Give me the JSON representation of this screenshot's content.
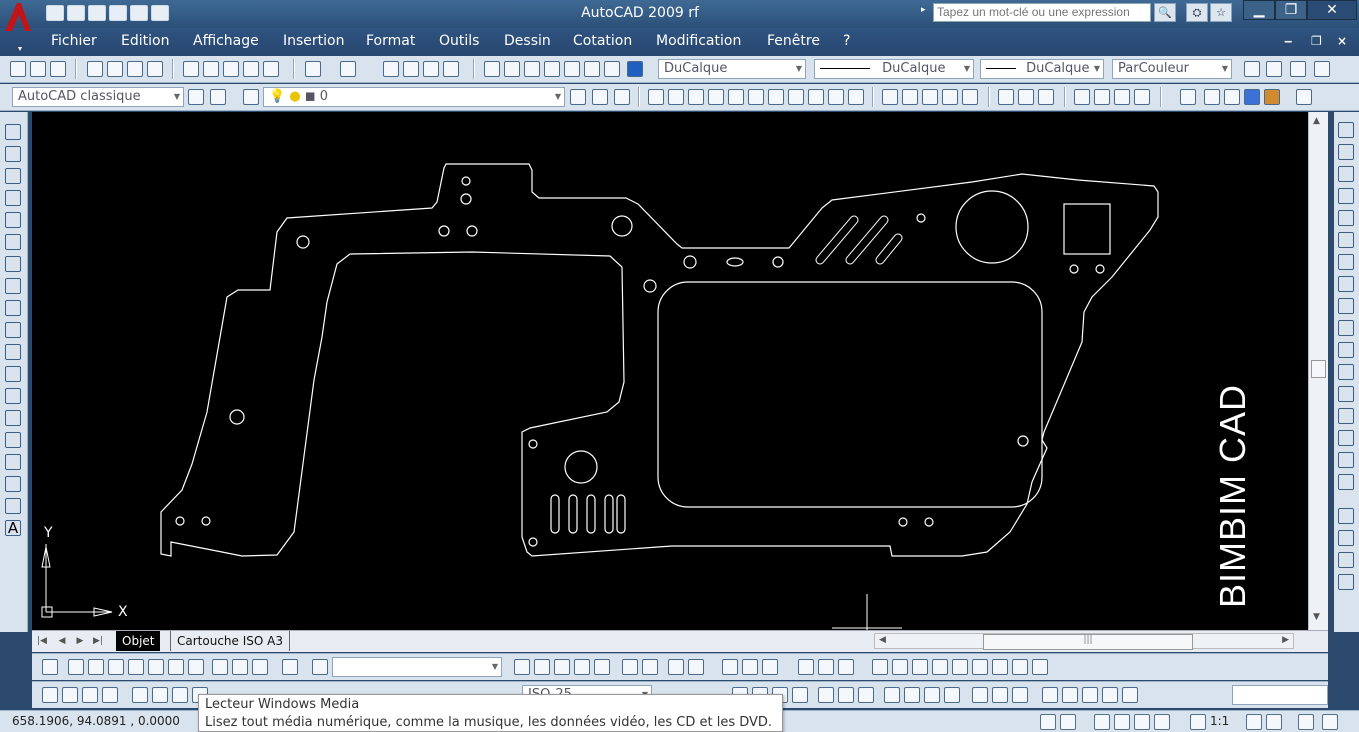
{
  "window": {
    "title": "AutoCAD 2009 rf",
    "search_placeholder": "Tapez un mot-clé ou une expression",
    "min_symbol": "▁",
    "restore_symbol": "❐",
    "close_symbol": "✕"
  },
  "menu": {
    "items": [
      "Fichier",
      "Edition",
      "Affichage",
      "Insertion",
      "Format",
      "Outils",
      "Dessin",
      "Cotation",
      "Modification",
      "Fenêtre",
      "?"
    ],
    "mdi_min": "‒",
    "mdi_restore": "❐",
    "mdi_close": "×"
  },
  "properties": {
    "color": "DuCalque",
    "linetype": "DuCalque",
    "lineweight": "DuCalque",
    "plotstyle": "ParCouleur"
  },
  "workspace": {
    "name": "AutoCAD classique",
    "layer": "0"
  },
  "canvas": {
    "watermark": "BIMBIM CAD",
    "ucs_x": "X",
    "ucs_y": "Y",
    "line_color": "#ffffff",
    "background": "#000000"
  },
  "tabs": {
    "items": [
      "Objet",
      "Cartouche ISO A3"
    ],
    "active": "Objet"
  },
  "annotation": {
    "dimstyle": "ISO-25"
  },
  "status": {
    "coordinates": "658.1906, 94.0891 , 0.0000",
    "scale": "1:1"
  },
  "tooltip": {
    "title": "Lecteur Windows Media",
    "description": "Lisez tout média numérique, comme la musique, les données vidéo, les CD et les DVD."
  },
  "colors": {
    "titlebar": "#3f6a95",
    "menubar": "#2f5480",
    "toolbar": "#d9e3ee",
    "autocad_red": "#c0161a"
  }
}
